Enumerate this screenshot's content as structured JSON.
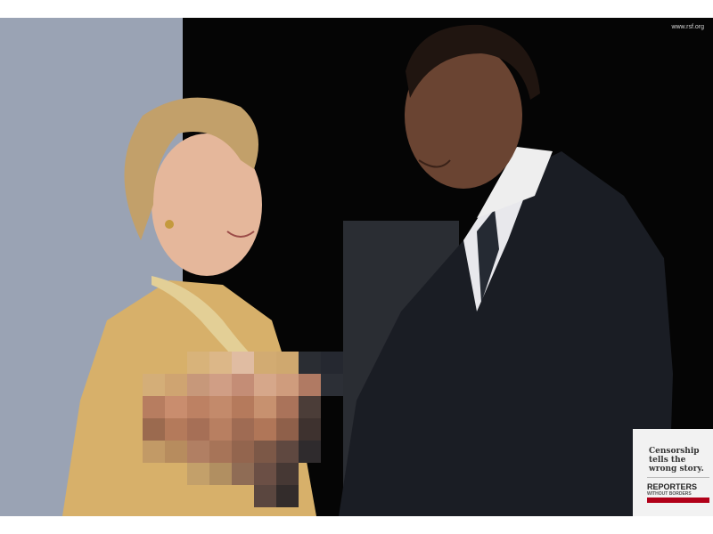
{
  "photo": {
    "url_text": "www.rsf.org",
    "card": {
      "headline": "Censorship tells the wrong story.",
      "brand_name": "REPORTERS",
      "brand_subtitle": "WITHOUT BORDERS"
    }
  }
}
